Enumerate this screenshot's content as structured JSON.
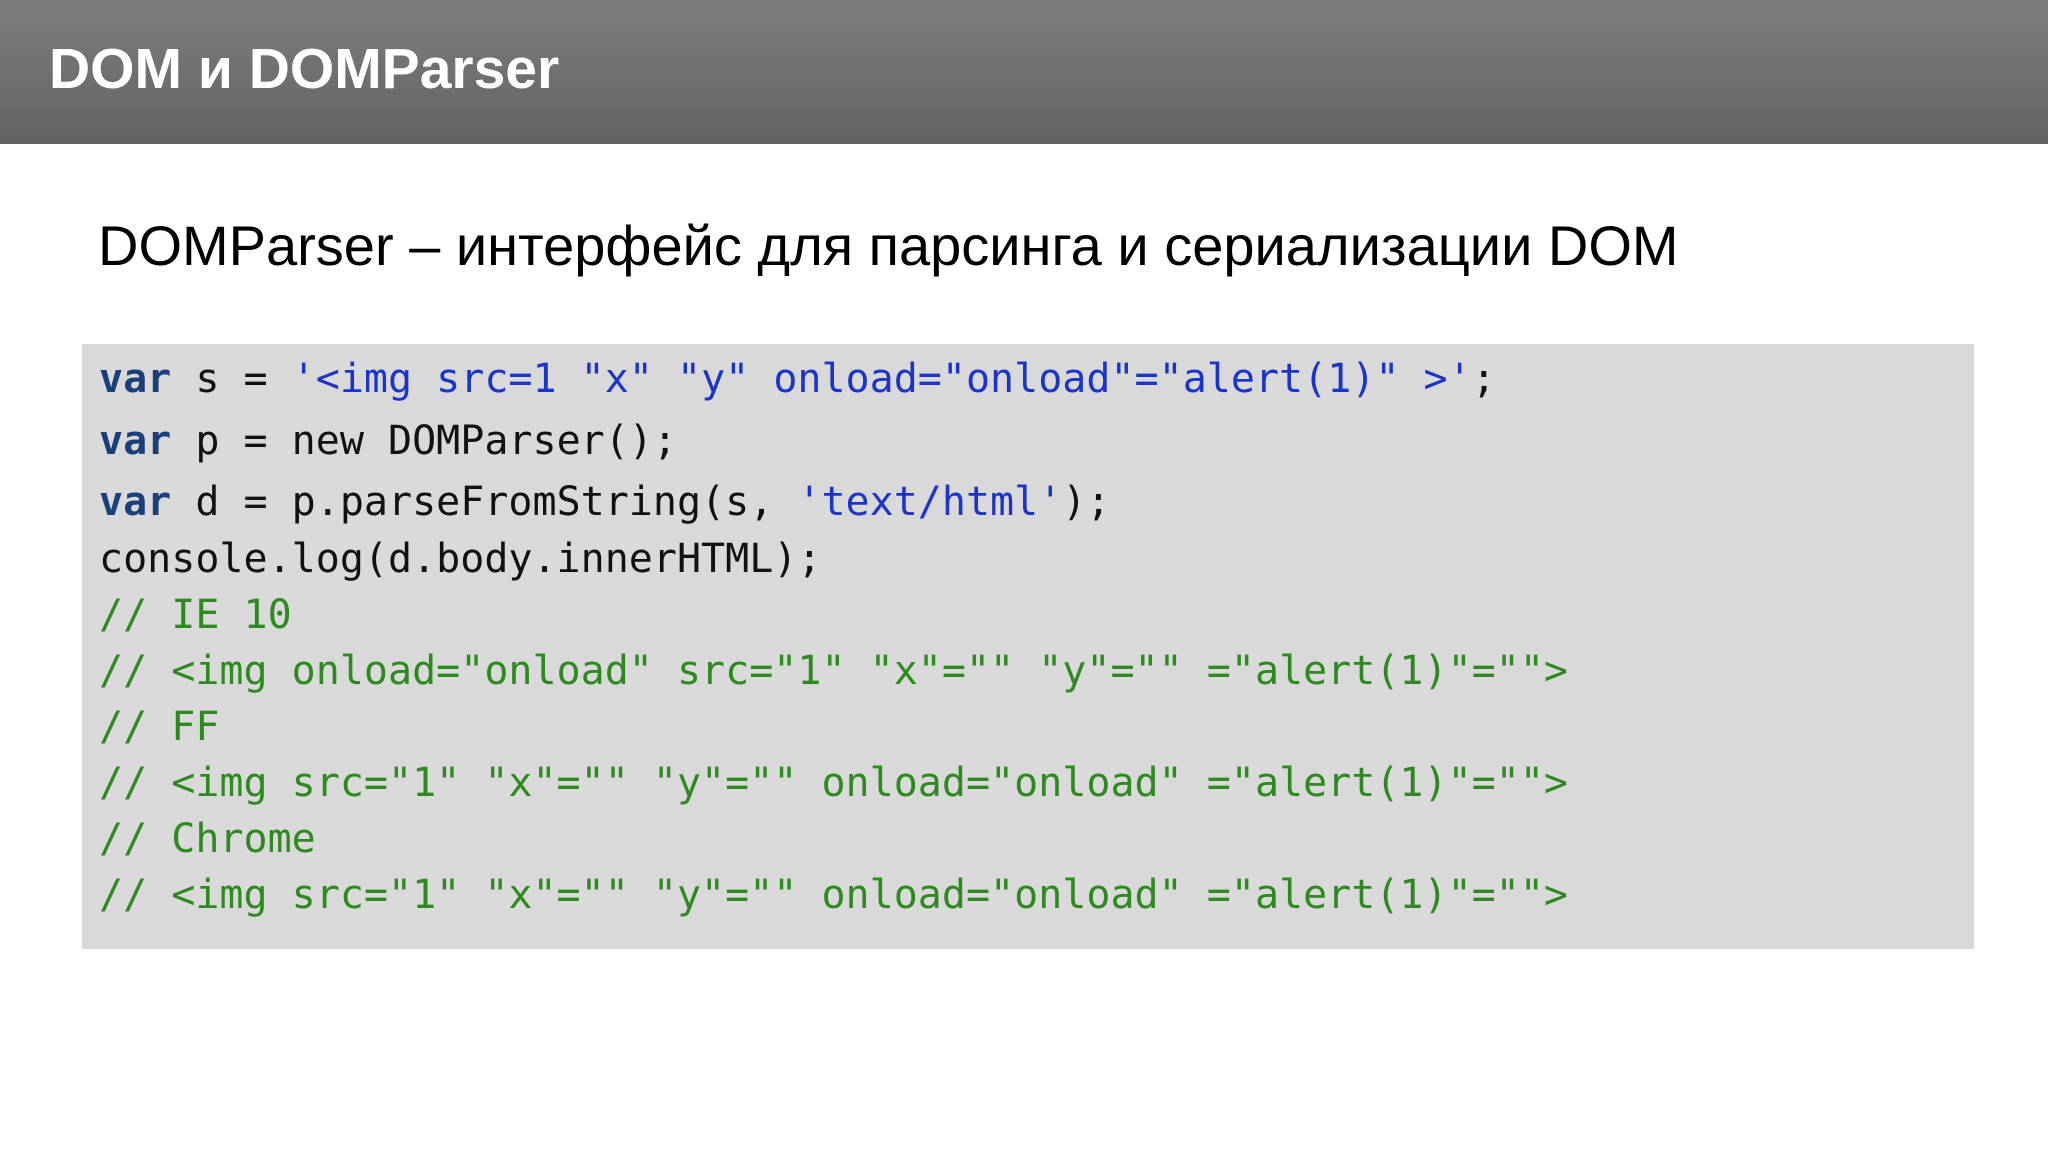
{
  "slide": {
    "title": "DOM и DOMParser",
    "subtitle": "DOMParser – интерфейс для парсинга и сериализации DOM"
  },
  "code": {
    "lines": [
      {
        "kw": "var",
        "plain": " s = ",
        "str": "'<img src=1 \"x\" \"y\" onload=\"onload\"=\"alert(1)\" >'",
        "tail": ";"
      },
      {
        "kw": "var",
        "plain": " p = new DOMParser();"
      },
      {
        "kw": "var",
        "plain": " d = p.parseFromString(s, ",
        "str": "'text/html'",
        "tail": ");"
      },
      {
        "plain": "console.log(d.body.innerHTML);"
      },
      {
        "comment": "// IE 10"
      },
      {
        "comment": "// <img onload=\"onload\" src=\"1\" \"x\"=\"\" \"y\"=\"\" =\"alert(1)\"=\"\">"
      },
      {
        "comment": "// FF"
      },
      {
        "comment": "// <img src=\"1\" \"x\"=\"\" \"y\"=\"\" onload=\"onload\" =\"alert(1)\"=\"\">"
      },
      {
        "comment": "// Chrome"
      },
      {
        "comment": "// <img src=\"1\" \"x\"=\"\" \"y\"=\"\" onload=\"onload\" =\"alert(1)\"=\"\">"
      }
    ]
  }
}
